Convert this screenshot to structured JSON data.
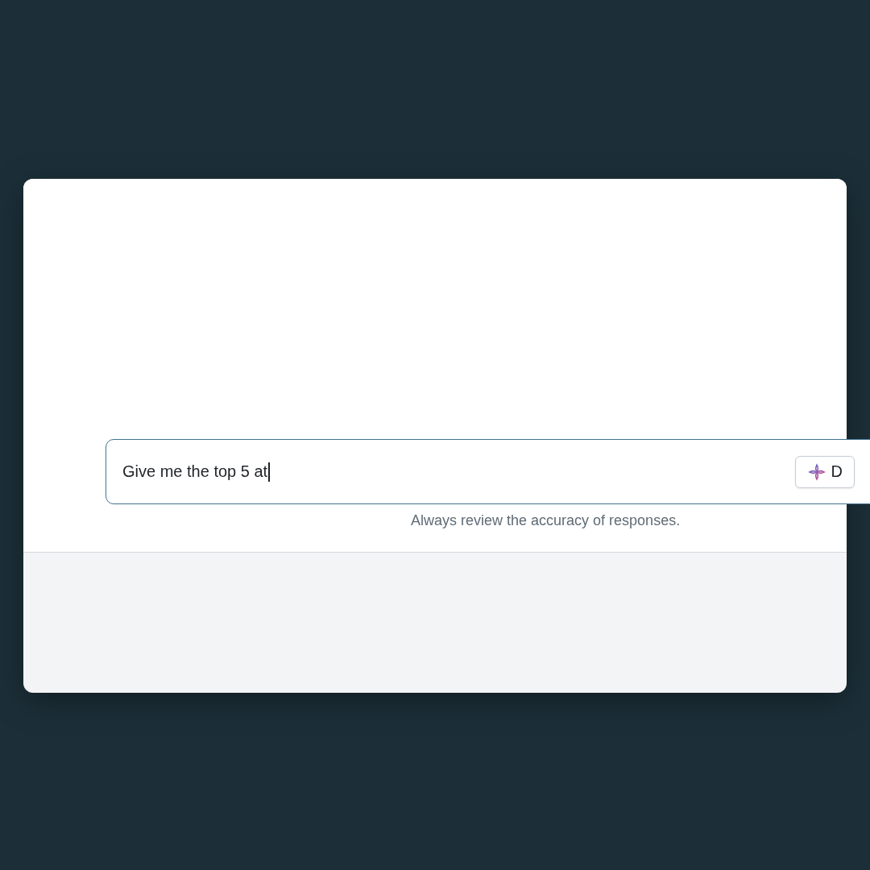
{
  "prompt_field": {
    "value": "Give me the top 5 at",
    "focused": true
  },
  "action_button": {
    "label": "D"
  },
  "disclaimer": "Always review the accuracy of responses."
}
